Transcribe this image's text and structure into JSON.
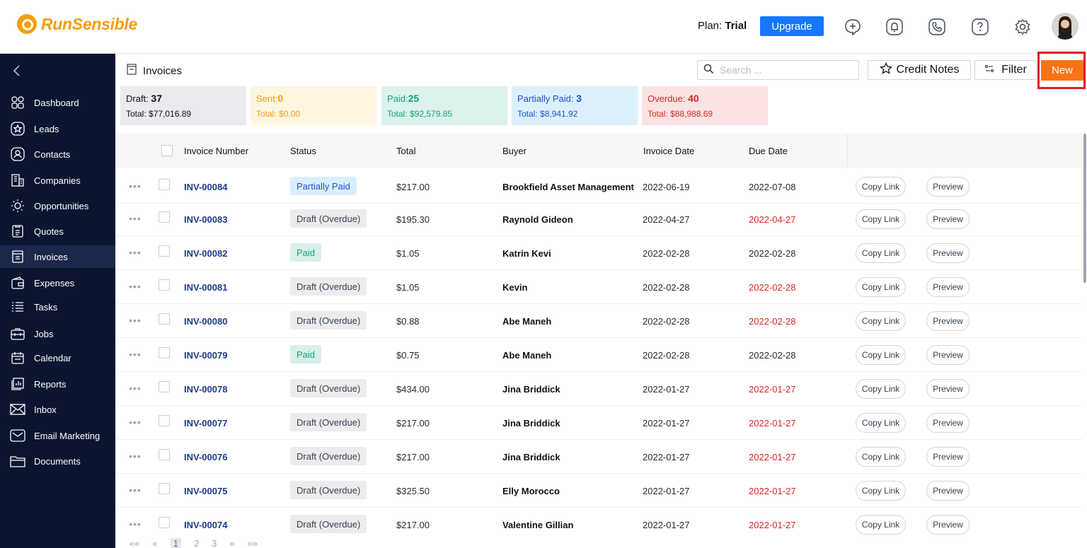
{
  "brand": {
    "name": "RunSensible"
  },
  "header": {
    "plan_label": "Plan:",
    "plan_value": "Trial",
    "upgrade_label": "Upgrade"
  },
  "sidebar": {
    "items": [
      {
        "label": "Dashboard",
        "icon": "dashboard-icon"
      },
      {
        "label": "Leads",
        "icon": "star-icon"
      },
      {
        "label": "Contacts",
        "icon": "contact-icon"
      },
      {
        "label": "Companies",
        "icon": "building-icon"
      },
      {
        "label": "Opportunities",
        "icon": "lightbulb-icon"
      },
      {
        "label": "Quotes",
        "icon": "quote-icon"
      },
      {
        "label": "Invoices",
        "icon": "invoice-icon",
        "active": true
      },
      {
        "label": "Expenses",
        "icon": "wallet-icon"
      },
      {
        "label": "Tasks",
        "icon": "tasks-icon"
      },
      {
        "label": "Jobs",
        "icon": "jobs-icon"
      },
      {
        "label": "Calendar",
        "icon": "calendar-icon"
      },
      {
        "label": "Reports",
        "icon": "reports-icon"
      },
      {
        "label": "Inbox",
        "icon": "inbox-icon"
      },
      {
        "label": "Email Marketing",
        "icon": "email-marketing-icon"
      },
      {
        "label": "Documents",
        "icon": "folder-icon"
      }
    ]
  },
  "page": {
    "title": "Invoices",
    "search_placeholder": "Search ...",
    "credit_notes_label": "Credit Notes",
    "filter_label": "Filter",
    "new_label": "New"
  },
  "summary": {
    "draft": {
      "label": "Draft:",
      "count": "37",
      "total": "Total: $77,016.89"
    },
    "sent": {
      "label": "Sent:",
      "count": "0",
      "total": "Total: $0.00"
    },
    "paid": {
      "label": "Paid:",
      "count": "25",
      "total": "Total: $92,579.85"
    },
    "partial": {
      "label": "Partially Paid:",
      "count": "3",
      "total": "Total: $8,941.92"
    },
    "overdue": {
      "label": "Overdue:",
      "count": "40",
      "total": "Total: $88,988.69"
    }
  },
  "table": {
    "columns": [
      "Invoice Number",
      "Status",
      "Total",
      "Buyer",
      "Invoice Date",
      "Due Date"
    ],
    "copy_link_label": "Copy Link",
    "preview_label": "Preview",
    "rows": [
      {
        "number": "INV-00084",
        "status": "Partially Paid",
        "total": "$217.00",
        "buyer": "Brookfield Asset Management",
        "invoice_date": "2022-06-19",
        "due_date": "2022-07-08"
      },
      {
        "number": "INV-00083",
        "status": "Draft (Overdue)",
        "total": "$195.30",
        "buyer": "Raynold Gideon",
        "invoice_date": "2022-04-27",
        "due_date": "2022-04-27"
      },
      {
        "number": "INV-00082",
        "status": "Paid",
        "total": "$1.05",
        "buyer": "Katrin Kevi",
        "invoice_date": "2022-02-28",
        "due_date": "2022-02-28"
      },
      {
        "number": "INV-00081",
        "status": "Draft (Overdue)",
        "total": "$1.05",
        "buyer": "Kevin",
        "invoice_date": "2022-02-28",
        "due_date": "2022-02-28"
      },
      {
        "number": "INV-00080",
        "status": "Draft (Overdue)",
        "total": "$0.88",
        "buyer": "Abe Maneh",
        "invoice_date": "2022-02-28",
        "due_date": "2022-02-28"
      },
      {
        "number": "INV-00079",
        "status": "Paid",
        "total": "$0.75",
        "buyer": "Abe Maneh",
        "invoice_date": "2022-02-28",
        "due_date": "2022-02-28"
      },
      {
        "number": "INV-00078",
        "status": "Draft (Overdue)",
        "total": "$434.00",
        "buyer": "Jina Briddick",
        "invoice_date": "2022-01-27",
        "due_date": "2022-01-27"
      },
      {
        "number": "INV-00077",
        "status": "Draft (Overdue)",
        "total": "$217.00",
        "buyer": "Jina Briddick",
        "invoice_date": "2022-01-27",
        "due_date": "2022-01-27"
      },
      {
        "number": "INV-00076",
        "status": "Draft (Overdue)",
        "total": "$217.00",
        "buyer": "Jina Briddick",
        "invoice_date": "2022-01-27",
        "due_date": "2022-01-27"
      },
      {
        "number": "INV-00075",
        "status": "Draft (Overdue)",
        "total": "$325.50",
        "buyer": "Elly Morocco",
        "invoice_date": "2022-01-27",
        "due_date": "2022-01-27"
      },
      {
        "number": "INV-00074",
        "status": "Draft (Overdue)",
        "total": "$217.00",
        "buyer": "Valentine Gillian",
        "invoice_date": "2022-01-27",
        "due_date": "2022-01-27"
      }
    ]
  },
  "pager": {
    "first": "««",
    "prev": "«",
    "pages": [
      "1",
      "2",
      "3"
    ],
    "next": "»",
    "last": "»»",
    "current": "1"
  },
  "colors": {
    "accent": "#f97316",
    "upgrade": "#1677ff",
    "sidebar": "#0b1530",
    "overdue": "#dc2626"
  }
}
